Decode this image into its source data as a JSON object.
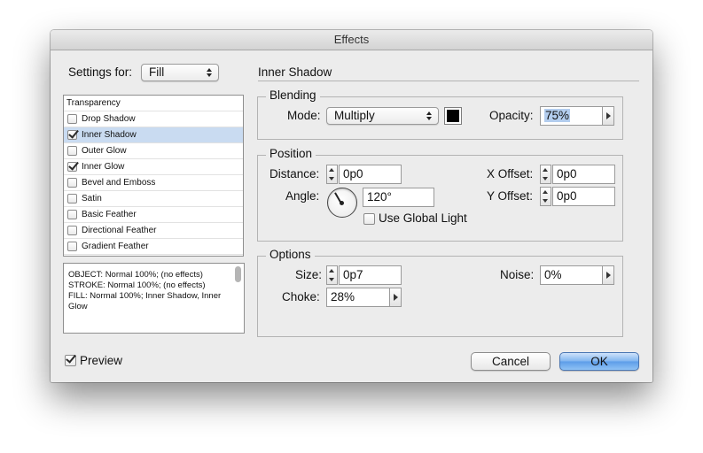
{
  "window": {
    "title": "Effects"
  },
  "settings_for": {
    "label": "Settings for:",
    "value": "Fill"
  },
  "effects_list": {
    "header": "Transparency",
    "items": [
      {
        "label": "Drop Shadow",
        "checked": false,
        "selected": false
      },
      {
        "label": "Inner Shadow",
        "checked": true,
        "selected": true
      },
      {
        "label": "Outer Glow",
        "checked": false,
        "selected": false
      },
      {
        "label": "Inner Glow",
        "checked": true,
        "selected": false
      },
      {
        "label": "Bevel and Emboss",
        "checked": false,
        "selected": false
      },
      {
        "label": "Satin",
        "checked": false,
        "selected": false
      },
      {
        "label": "Basic Feather",
        "checked": false,
        "selected": false
      },
      {
        "label": "Directional Feather",
        "checked": false,
        "selected": false
      },
      {
        "label": "Gradient Feather",
        "checked": false,
        "selected": false
      }
    ]
  },
  "summary": {
    "lines": [
      "OBJECT: Normal 100%; (no effects)",
      "STROKE: Normal 100%; (no effects)",
      "FILL: Normal 100%; Inner Shadow, Inner",
      "Glow"
    ]
  },
  "panel": {
    "title": "Inner Shadow"
  },
  "blending": {
    "legend": "Blending",
    "mode_label": "Mode:",
    "mode_value": "Multiply",
    "color": "#000000",
    "opacity_label": "Opacity:",
    "opacity_value": "75%"
  },
  "position": {
    "legend": "Position",
    "distance_label": "Distance:",
    "distance_value": "0p0",
    "angle_label": "Angle:",
    "angle_value": "120°",
    "angle_degrees": 120,
    "global_light_label": "Use Global Light",
    "global_light_checked": false,
    "x_offset_label": "X Offset:",
    "x_offset_value": "0p0",
    "y_offset_label": "Y Offset:",
    "y_offset_value": "0p0"
  },
  "options": {
    "legend": "Options",
    "size_label": "Size:",
    "size_value": "0p7",
    "choke_label": "Choke:",
    "choke_value": "28%",
    "noise_label": "Noise:",
    "noise_value": "0%"
  },
  "footer": {
    "preview_label": "Preview",
    "preview_checked": true,
    "cancel_label": "Cancel",
    "ok_label": "OK"
  }
}
